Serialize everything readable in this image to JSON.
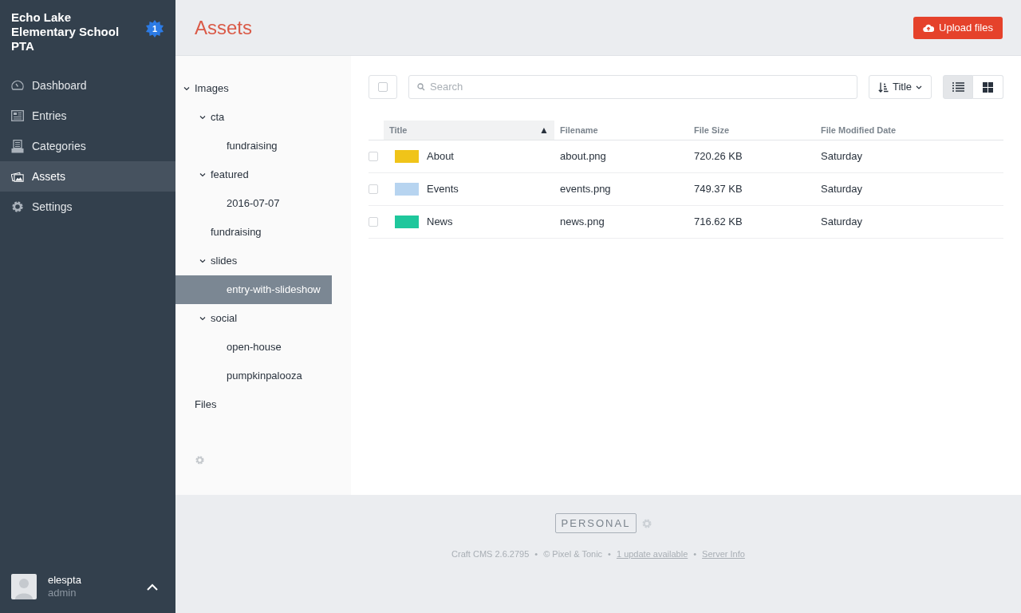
{
  "site": {
    "name": "Echo Lake Elementary School PTA",
    "badge": "1"
  },
  "nav": [
    {
      "label": "Dashboard",
      "selected": false
    },
    {
      "label": "Entries",
      "selected": false
    },
    {
      "label": "Categories",
      "selected": false
    },
    {
      "label": "Assets",
      "selected": true
    },
    {
      "label": "Settings",
      "selected": false
    }
  ],
  "user": {
    "name": "elespta",
    "role": "admin"
  },
  "page_title": "Assets",
  "upload_button": "Upload files",
  "tree": [
    {
      "label": "Images",
      "expanded": true,
      "selected": false,
      "children": [
        {
          "label": "cta",
          "expanded": true,
          "selected": false,
          "children": [
            {
              "label": "fundraising",
              "selected": false
            }
          ]
        },
        {
          "label": "featured",
          "expanded": true,
          "selected": false,
          "children": [
            {
              "label": "2016-07-07",
              "selected": false
            }
          ]
        },
        {
          "label": "fundraising",
          "selected": false
        },
        {
          "label": "slides",
          "expanded": true,
          "selected": false,
          "children": [
            {
              "label": "entry-with-slideshow",
              "selected": true
            }
          ]
        },
        {
          "label": "social",
          "expanded": true,
          "selected": false,
          "children": [
            {
              "label": "open-house",
              "selected": false
            },
            {
              "label": "pumpkinpalooza",
              "selected": false
            }
          ]
        }
      ]
    },
    {
      "label": "Files",
      "selected": false
    }
  ],
  "select_all": {
    "checked": false
  },
  "search": {
    "placeholder": "Search"
  },
  "sort_button": "Title",
  "views": [
    {
      "kind": "list",
      "selected": true
    },
    {
      "kind": "grid",
      "selected": false
    }
  ],
  "table": {
    "columns": [
      {
        "label": "Title",
        "sorted": true,
        "sort_mark": "▲"
      },
      {
        "label": "Filename",
        "sorted": false
      },
      {
        "label": "File Size",
        "sorted": false
      },
      {
        "label": "File Modified Date",
        "sorted": false
      }
    ],
    "rows": [
      {
        "checked": false,
        "color": "#f0c419",
        "title": "About",
        "filename": "about.png",
        "size": "720.26 KB",
        "modified": "Saturday"
      },
      {
        "checked": false,
        "color": "#b7d4f0",
        "title": "Events",
        "filename": "events.png",
        "size": "749.37 KB",
        "modified": "Saturday"
      },
      {
        "checked": false,
        "color": "#1fc79c",
        "title": "News",
        "filename": "news.png",
        "size": "716.62 KB",
        "modified": "Saturday"
      }
    ]
  },
  "footer": {
    "edition": "PERSONAL",
    "items": [
      {
        "kind": "text",
        "label": "Craft CMS 2.6.2795"
      },
      {
        "kind": "text",
        "label": "© Pixel & Tonic"
      },
      {
        "kind": "link",
        "label": "1 update available"
      },
      {
        "kind": "link",
        "label": "Server Info"
      }
    ],
    "separator": "•"
  }
}
